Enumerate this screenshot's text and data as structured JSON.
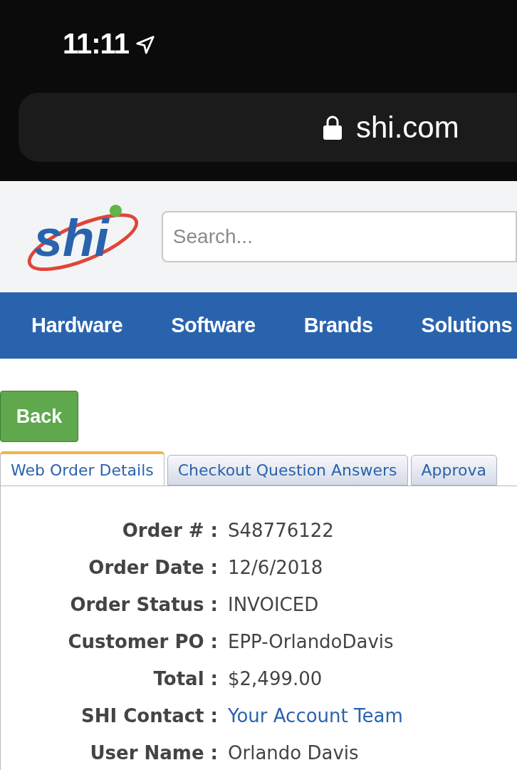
{
  "status_bar": {
    "time": "11:11"
  },
  "browser": {
    "url": "shi.com"
  },
  "header": {
    "logo_text": "shi",
    "search": {
      "placeholder": "Search..."
    }
  },
  "nav": [
    "Hardware",
    "Software",
    "Brands",
    "Solutions"
  ],
  "back_button": "Back",
  "tabs": [
    {
      "label": "Web Order Details",
      "selected": true
    },
    {
      "label": "Checkout Question Answers",
      "selected": false
    },
    {
      "label": "Approva",
      "selected": false
    }
  ],
  "details": [
    {
      "label": "Order # :",
      "value": "S48776122",
      "kind": "text"
    },
    {
      "label": "Order Date :",
      "value": "12/6/2018",
      "kind": "text"
    },
    {
      "label": "Order Status :",
      "value": "INVOICED",
      "kind": "text"
    },
    {
      "label": "Customer PO :",
      "value": "EPP-OrlandoDavis",
      "kind": "text"
    },
    {
      "label": "Total :",
      "value": "$2,499.00",
      "kind": "text"
    },
    {
      "label": "SHI Contact :",
      "value": "Your Account Team",
      "kind": "link"
    },
    {
      "label": "User Name :",
      "value": "Orlando Davis",
      "kind": "text"
    }
  ]
}
